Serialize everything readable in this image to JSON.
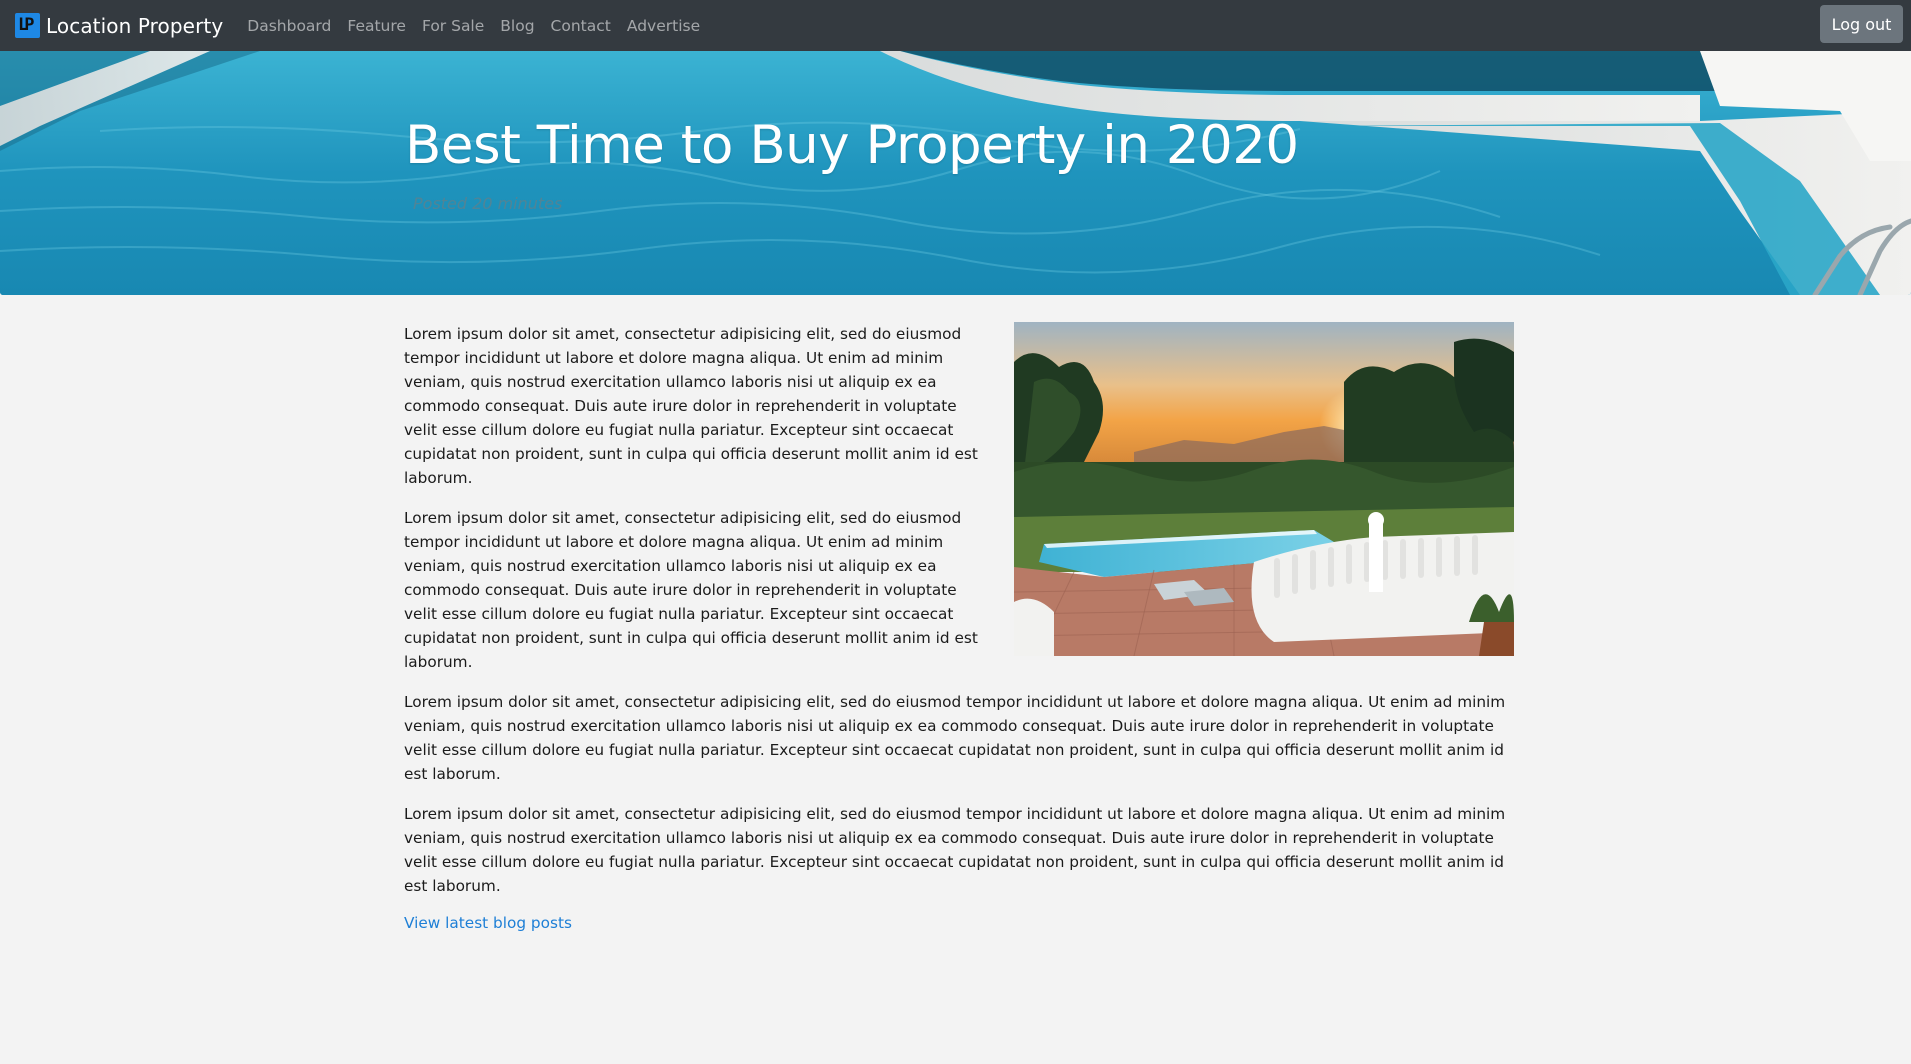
{
  "navbar": {
    "brand_logo_text": "LP",
    "brand_name": "Location Property",
    "links": [
      {
        "label": "Dashboard"
      },
      {
        "label": "Feature"
      },
      {
        "label": "For Sale"
      },
      {
        "label": "Blog"
      },
      {
        "label": "Contact"
      },
      {
        "label": "Advertise"
      }
    ],
    "logout_label": "Log out"
  },
  "hero": {
    "title": "Best Time to Buy Property in 2020",
    "subtitle": "Posted 20 minutes"
  },
  "article": {
    "paragraphs": [
      "Lorem ipsum dolor sit amet, consectetur adipisicing elit, sed do eiusmod tempor incididunt ut labore et dolore magna aliqua. Ut enim ad minim veniam, quis nostrud exercitation ullamco laboris nisi ut aliquip ex ea commodo consequat. Duis aute irure dolor in reprehenderit in voluptate velit esse cillum dolore eu fugiat nulla pariatur. Excepteur sint occaecat cupidatat non proident, sunt in culpa qui officia deserunt mollit anim id est laborum.",
      "Lorem ipsum dolor sit amet, consectetur adipisicing elit, sed do eiusmod tempor incididunt ut labore et dolore magna aliqua. Ut enim ad minim veniam, quis nostrud exercitation ullamco laboris nisi ut aliquip ex ea commodo consequat. Duis aute irure dolor in reprehenderit in voluptate velit esse cillum dolore eu fugiat nulla pariatur. Excepteur sint occaecat cupidatat non proident, sunt in culpa qui officia deserunt mollit anim id est laborum.",
      "Lorem ipsum dolor sit amet, consectetur adipisicing elit, sed do eiusmod tempor incididunt ut labore et dolore magna aliqua. Ut enim ad minim veniam, quis nostrud exercitation ullamco laboris nisi ut aliquip ex ea commodo consequat. Duis aute irure dolor in reprehenderit in voluptate velit esse cillum dolore eu fugiat nulla pariatur. Excepteur sint occaecat cupidatat non proident, sunt in culpa qui officia deserunt mollit anim id est laborum.",
      "Lorem ipsum dolor sit amet, consectetur adipisicing elit, sed do eiusmod tempor incididunt ut labore et dolore magna aliqua. Ut enim ad minim veniam, quis nostrud exercitation ullamco laboris nisi ut aliquip ex ea commodo consequat. Duis aute irure dolor in reprehenderit in voluptate velit esse cillum dolore eu fugiat nulla pariatur. Excepteur sint occaecat cupidatat non proident, sunt in culpa qui officia deserunt mollit anim id est laborum."
    ],
    "link_label": "View latest blog posts"
  },
  "colors": {
    "navbar_bg": "#343a40",
    "link": "#1e7fd6",
    "page_bg": "#f3f3f3",
    "logout_bg": "#6c757d"
  }
}
